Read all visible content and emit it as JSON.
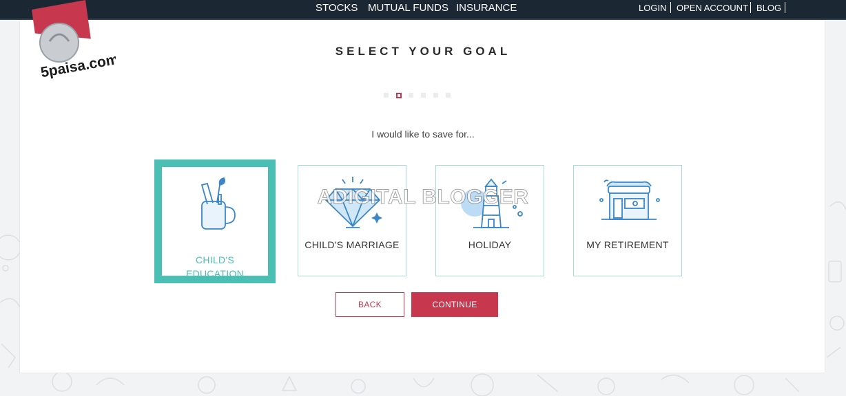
{
  "nav": {
    "main": [
      "STOCKS",
      "MUTUAL FUNDS",
      "INSURANCE"
    ],
    "right": [
      "LOGIN",
      "OPEN ACCOUNT",
      "BLOG"
    ]
  },
  "logo": {
    "text": "5paisa.com",
    "brand_color": "#c7384f"
  },
  "page": {
    "title": "SELECT YOUR GOAL",
    "prompt": "I would like to save for...",
    "step_current": 2,
    "step_total": 6
  },
  "goals": [
    {
      "line1": "CHILD'S",
      "line2": "EDUCATION",
      "icon": "education-icon",
      "selected": true
    },
    {
      "label": "CHILD'S MARRIAGE",
      "icon": "diamond-icon",
      "selected": false
    },
    {
      "label": "HOLIDAY",
      "icon": "lighthouse-icon",
      "selected": false
    },
    {
      "label": "MY RETIREMENT",
      "icon": "house-icon",
      "selected": false
    }
  ],
  "buttons": {
    "back": "BACK",
    "continue": "CONTINUE"
  },
  "watermark": "ADIGITAL BLOGGER",
  "colors": {
    "accent": "#c7384f",
    "teal": "#4bbfb4",
    "icon_blue": "#3a86c8",
    "nav_bg": "#1b2733"
  }
}
